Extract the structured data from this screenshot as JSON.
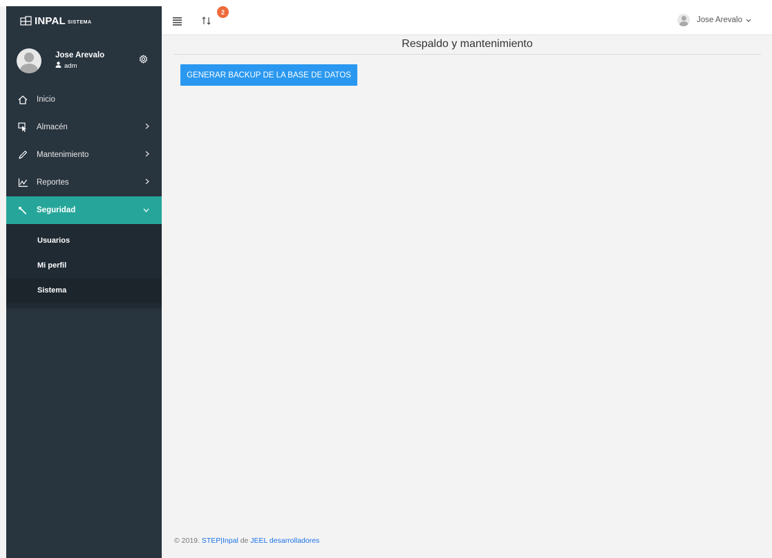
{
  "app": {
    "brand_name": "INPAL",
    "brand_sub": "SISTEMA"
  },
  "profile": {
    "name": "Jose Arevalo",
    "role": "adm"
  },
  "sidebar": {
    "items": [
      {
        "label": "Inicio",
        "icon": "home-icon"
      },
      {
        "label": "Almacén",
        "icon": "cursor-icon"
      },
      {
        "label": "Mantenimiento",
        "icon": "pencil-icon"
      },
      {
        "label": "Reportes",
        "icon": "chart-icon"
      },
      {
        "label": "Seguridad",
        "icon": "wrench-icon"
      }
    ],
    "submenu": [
      {
        "label": "Usuarios"
      },
      {
        "label": "Mi perfil"
      },
      {
        "label": "Sistema"
      }
    ]
  },
  "header": {
    "notification_count": "2",
    "user_name": "Jose Arevalo"
  },
  "main": {
    "title": "Respaldo y mantenimiento",
    "backup_button": "GENERAR BACKUP DE LA BASE DE DATOS"
  },
  "footer": {
    "prefix": "© 2019. ",
    "link1": "STEP|Inpal",
    "middle": " de ",
    "link2": "JEEL desarrolladores"
  },
  "colors": {
    "sidebar_bg": "#28343e",
    "active_item": "#26a69a",
    "button": "#2a98f0",
    "badge": "#ef6a3a"
  }
}
